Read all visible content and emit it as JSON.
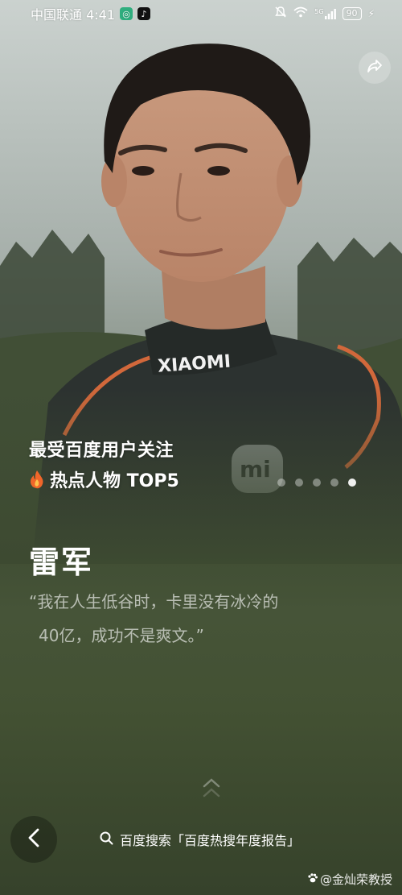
{
  "status_bar": {
    "carrier_time": "中国联通 4:41",
    "network_label": "5G",
    "battery": "90"
  },
  "hero": {
    "jacket_logo": "XIAOMI",
    "patch_logo": "mi"
  },
  "badge": {
    "line1": "最受百度用户关注",
    "line2": "热点人物 TOP5"
  },
  "pager": {
    "count": 5,
    "active_index": 4
  },
  "person": {
    "name": "雷军",
    "quote_line1": "“我在人生低谷时，卡里没有冰冷的",
    "quote_line2": "40亿，成功不是爽文。”"
  },
  "search_hint": {
    "text": "百度搜索「百度热搜年度报告」"
  },
  "watermark": {
    "text": "@金灿荣教授"
  },
  "icons": [
    "share-icon",
    "fire-icon",
    "chevron-up-icon",
    "back-arrow-icon",
    "search-icon",
    "wifi-icon",
    "signal-icon",
    "battery-icon",
    "mute-icon"
  ],
  "colors": {
    "jacket_orange": "#d2683b",
    "background_green": "#3d4a31"
  }
}
